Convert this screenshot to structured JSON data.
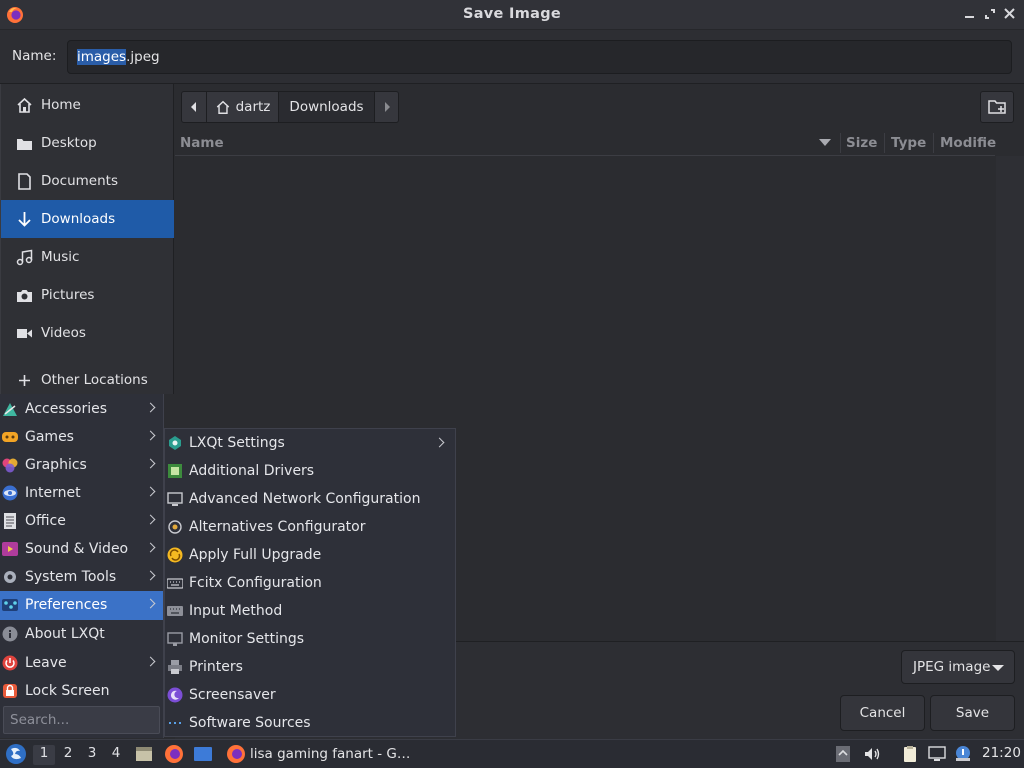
{
  "window": {
    "title": "Save Image",
    "icon": "firefox-icon"
  },
  "name_field": {
    "label": "Name:",
    "value_selected": "images",
    "value_rest": ".jpeg"
  },
  "sidebar": {
    "items": [
      {
        "label": "Home",
        "icon": "home-icon"
      },
      {
        "label": "Desktop",
        "icon": "folder-icon"
      },
      {
        "label": "Documents",
        "icon": "document-icon"
      },
      {
        "label": "Downloads",
        "icon": "download-icon",
        "active": true
      },
      {
        "label": "Music",
        "icon": "music-icon"
      },
      {
        "label": "Pictures",
        "icon": "camera-icon"
      },
      {
        "label": "Videos",
        "icon": "video-icon"
      },
      {
        "label": "Other Locations",
        "icon": "plus-icon"
      }
    ]
  },
  "pathbar": {
    "home": "dartz",
    "current": "Downloads"
  },
  "columns": {
    "name": "Name",
    "size": "Size",
    "type": "Type",
    "modified": "Modifie"
  },
  "file_type": {
    "selected": "JPEG image"
  },
  "buttons": {
    "cancel": "Cancel",
    "save": "Save"
  },
  "app_menu": {
    "items": [
      {
        "label": "Accessories",
        "submenu": true
      },
      {
        "label": "Games",
        "submenu": true
      },
      {
        "label": "Graphics",
        "submenu": true
      },
      {
        "label": "Internet",
        "submenu": true
      },
      {
        "label": "Office",
        "submenu": true
      },
      {
        "label": "Sound & Video",
        "submenu": true
      },
      {
        "label": "System Tools",
        "submenu": true
      },
      {
        "label": "Preferences",
        "submenu": true,
        "active": true
      },
      {
        "label": "About LXQt",
        "submenu": false
      },
      {
        "label": "Leave",
        "submenu": true
      },
      {
        "label": "Lock Screen",
        "submenu": false
      }
    ],
    "search_placeholder": "Search..."
  },
  "preferences_menu": {
    "items": [
      {
        "label": "LXQt Settings",
        "submenu": true
      },
      {
        "label": "Additional Drivers"
      },
      {
        "label": "Advanced Network Configuration"
      },
      {
        "label": "Alternatives Configurator"
      },
      {
        "label": "Apply Full Upgrade"
      },
      {
        "label": "Fcitx Configuration"
      },
      {
        "label": "Input Method"
      },
      {
        "label": "Monitor Settings"
      },
      {
        "label": "Printers"
      },
      {
        "label": "Screensaver"
      },
      {
        "label": "Software Sources"
      }
    ]
  },
  "taskbar": {
    "workspaces": [
      "1",
      "2",
      "3",
      "4"
    ],
    "task_title": "lisa gaming fanart - G…",
    "clock": "21:20"
  }
}
